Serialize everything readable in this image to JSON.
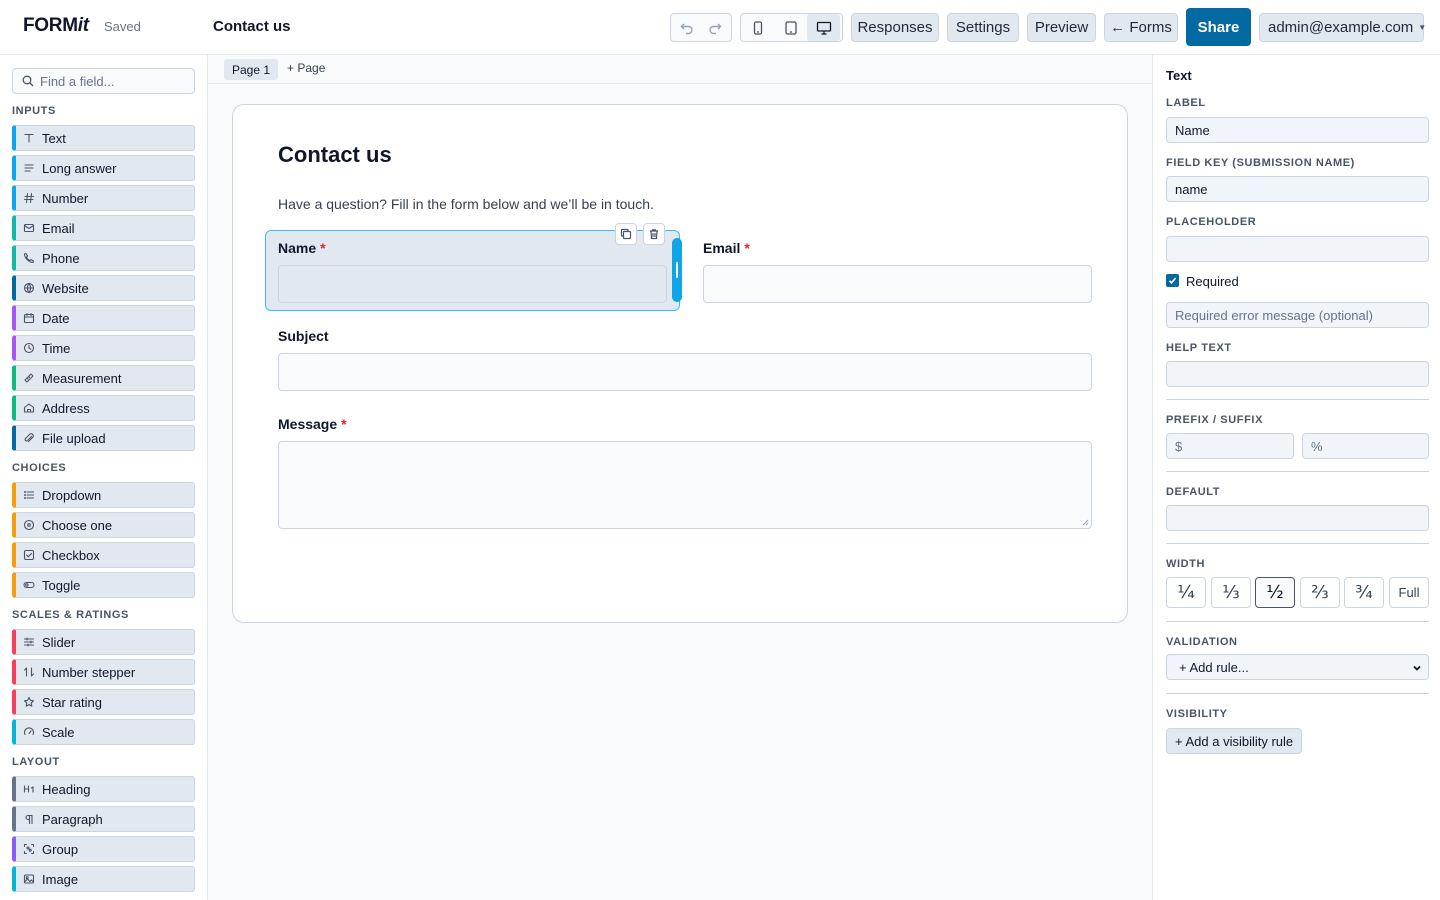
{
  "header": {
    "brand_main": "FORM",
    "brand_italic": "it",
    "status": "Saved",
    "title": "Contact us",
    "buttons": {
      "responses": "Responses",
      "settings": "Settings",
      "preview": "Preview",
      "forms": "← Forms",
      "share": "Share"
    },
    "user": "admin@example.com",
    "device_active": "desktop"
  },
  "sidebar": {
    "search_placeholder": "Find a field...",
    "sections": [
      {
        "title": "INPUTS",
        "items": [
          {
            "label": "Text",
            "icon": "text-icon",
            "color": "#0ea5e9"
          },
          {
            "label": "Long answer",
            "icon": "lines-icon",
            "color": "#0ea5e9"
          },
          {
            "label": "Number",
            "icon": "hash-icon",
            "color": "#0ea5e9"
          },
          {
            "label": "Email",
            "icon": "mail-icon",
            "color": "#14b8a6"
          },
          {
            "label": "Phone",
            "icon": "phone-icon",
            "color": "#14b8a6"
          },
          {
            "label": "Website",
            "icon": "globe-icon",
            "color": "#0369a1"
          },
          {
            "label": "Date",
            "icon": "calendar-icon",
            "color": "#a855f7"
          },
          {
            "label": "Time",
            "icon": "clock-icon",
            "color": "#a855f7"
          },
          {
            "label": "Measurement",
            "icon": "ruler-icon",
            "color": "#10b981"
          },
          {
            "label": "Address",
            "icon": "home-icon",
            "color": "#10b981"
          },
          {
            "label": "File upload",
            "icon": "paperclip-icon",
            "color": "#0369a1"
          }
        ]
      },
      {
        "title": "CHOICES",
        "items": [
          {
            "label": "Dropdown",
            "icon": "list-icon",
            "color": "#f59e0b"
          },
          {
            "label": "Choose one",
            "icon": "radio-icon",
            "color": "#f59e0b"
          },
          {
            "label": "Checkbox",
            "icon": "checkbox-icon",
            "color": "#f59e0b"
          },
          {
            "label": "Toggle",
            "icon": "toggle-icon",
            "color": "#f59e0b"
          }
        ]
      },
      {
        "title": "SCALES & RATINGS",
        "items": [
          {
            "label": "Slider",
            "icon": "sliders-icon",
            "color": "#f43f5e"
          },
          {
            "label": "Number stepper",
            "icon": "arrows-icon",
            "color": "#f43f5e"
          },
          {
            "label": "Star rating",
            "icon": "star-icon",
            "color": "#f43f5e"
          },
          {
            "label": "Scale",
            "icon": "gauge-icon",
            "color": "#06b6d4"
          }
        ]
      },
      {
        "title": "LAYOUT",
        "items": [
          {
            "label": "Heading",
            "icon": "heading-icon",
            "color": "#64748b"
          },
          {
            "label": "Paragraph",
            "icon": "pilcrow-icon",
            "color": "#64748b"
          },
          {
            "label": "Group",
            "icon": "group-icon",
            "color": "#8b5cf6"
          },
          {
            "label": "Image",
            "icon": "image-icon",
            "color": "#06b6d4"
          }
        ]
      }
    ]
  },
  "pages": {
    "current": "Page 1",
    "add": "+ Page"
  },
  "form": {
    "title": "Contact us",
    "description": "Have a question? Fill in the form below and we’ll be in touch.",
    "fields": {
      "name": {
        "label": "Name",
        "required_mark": "*"
      },
      "email": {
        "label": "Email",
        "required_mark": "*"
      },
      "subject": {
        "label": "Subject"
      },
      "message": {
        "label": "Message",
        "required_mark": "*"
      }
    }
  },
  "properties": {
    "title": "Text",
    "label_heading": "LABEL",
    "label_value": "Name",
    "key_heading": "FIELD KEY (SUBMISSION NAME)",
    "key_value": "name",
    "placeholder_heading": "PLACEHOLDER",
    "placeholder_value": "",
    "required_label": "Required",
    "required_checked": true,
    "error_placeholder": "Required error message (optional)",
    "help_heading": "HELP TEXT",
    "prefix_heading": "PREFIX / SUFFIX",
    "prefix_placeholder": "$",
    "suffix_placeholder": "%",
    "default_heading": "DEFAULT",
    "width_heading": "WIDTH",
    "width_options": [
      "¼",
      "⅓",
      "½",
      "⅔",
      "¾",
      "Full"
    ],
    "width_selected": "½",
    "validation_heading": "VALIDATION",
    "validation_select": "+ Add rule...",
    "visibility_heading": "VISIBILITY",
    "visibility_button": "+ Add a visibility rule"
  },
  "colors": {
    "accent": "#0369a1",
    "selection": "#0ea5e9",
    "required": "#dc2626"
  }
}
